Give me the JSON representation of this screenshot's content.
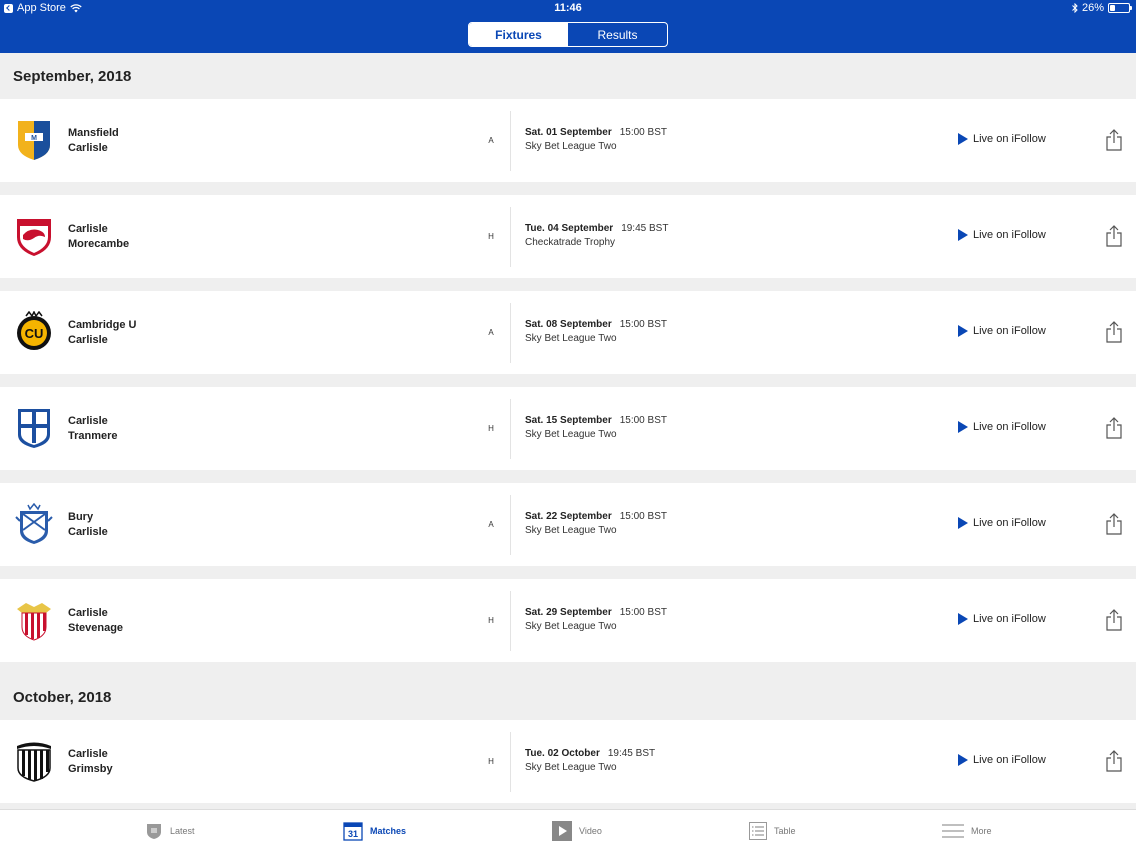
{
  "status_bar": {
    "back_app": "App Store",
    "time": "11:46",
    "battery_percent": "26%",
    "battery_level": 0.26
  },
  "segment": {
    "fixtures_label": "Fixtures",
    "results_label": "Results",
    "selected": "Fixtures"
  },
  "months": [
    {
      "label": "September, 2018"
    },
    {
      "label": "October, 2018"
    }
  ],
  "fixtures": [
    {
      "home": "Mansfield",
      "away": "Carlisle",
      "venue": "A",
      "date": "Sat. 01 September",
      "time": "15:00 BST",
      "competition": "Sky Bet League Two",
      "live_label": "Live on iFollow"
    },
    {
      "home": "Carlisle",
      "away": "Morecambe",
      "venue": "H",
      "date": "Tue. 04 September",
      "time": "19:45 BST",
      "competition": "Checkatrade Trophy",
      "live_label": "Live on iFollow"
    },
    {
      "home": "Cambridge U",
      "away": "Carlisle",
      "venue": "A",
      "date": "Sat. 08 September",
      "time": "15:00 BST",
      "competition": "Sky Bet League Two",
      "live_label": "Live on iFollow"
    },
    {
      "home": "Carlisle",
      "away": "Tranmere",
      "venue": "H",
      "date": "Sat. 15 September",
      "time": "15:00 BST",
      "competition": "Sky Bet League Two",
      "live_label": "Live on iFollow"
    },
    {
      "home": "Bury",
      "away": "Carlisle",
      "venue": "A",
      "date": "Sat. 22 September",
      "time": "15:00 BST",
      "competition": "Sky Bet League Two",
      "live_label": "Live on iFollow"
    },
    {
      "home": "Carlisle",
      "away": "Stevenage",
      "venue": "H",
      "date": "Sat. 29 September",
      "time": "15:00 BST",
      "competition": "Sky Bet League Two",
      "live_label": "Live on iFollow"
    },
    {
      "home": "Carlisle",
      "away": "Grimsby",
      "venue": "H",
      "date": "Tue. 02 October",
      "time": "19:45 BST",
      "competition": "Sky Bet League Two",
      "live_label": "Live on iFollow"
    }
  ],
  "crests": [
    {
      "icon": "mansfield-crest-icon",
      "colors": [
        "#f2b21c",
        "#1a4f9c"
      ]
    },
    {
      "icon": "morecambe-crest-icon",
      "colors": [
        "#c8102e",
        "#ffffff"
      ]
    },
    {
      "icon": "cambridge-crest-icon",
      "colors": [
        "#f5b400",
        "#111111"
      ]
    },
    {
      "icon": "tranmere-crest-icon",
      "colors": [
        "#1c4fa0",
        "#ffffff"
      ]
    },
    {
      "icon": "bury-crest-icon",
      "colors": [
        "#2a5cab",
        "#ffffff"
      ]
    },
    {
      "icon": "stevenage-crest-icon",
      "colors": [
        "#c8102e",
        "#e8c547"
      ]
    },
    {
      "icon": "grimsby-crest-icon",
      "colors": [
        "#111111",
        "#ffffff"
      ]
    }
  ],
  "tabs": [
    {
      "label": "Latest",
      "icon": "club-crest-icon"
    },
    {
      "label": "Matches",
      "icon": "calendar-icon",
      "calendar_day": "31",
      "active": true
    },
    {
      "label": "Video",
      "icon": "play-video-icon"
    },
    {
      "label": "Table",
      "icon": "table-list-icon"
    },
    {
      "label": "More",
      "icon": "menu-lines-icon"
    }
  ],
  "colors": {
    "brand_blue": "#0a47b5",
    "background": "#efefef"
  }
}
